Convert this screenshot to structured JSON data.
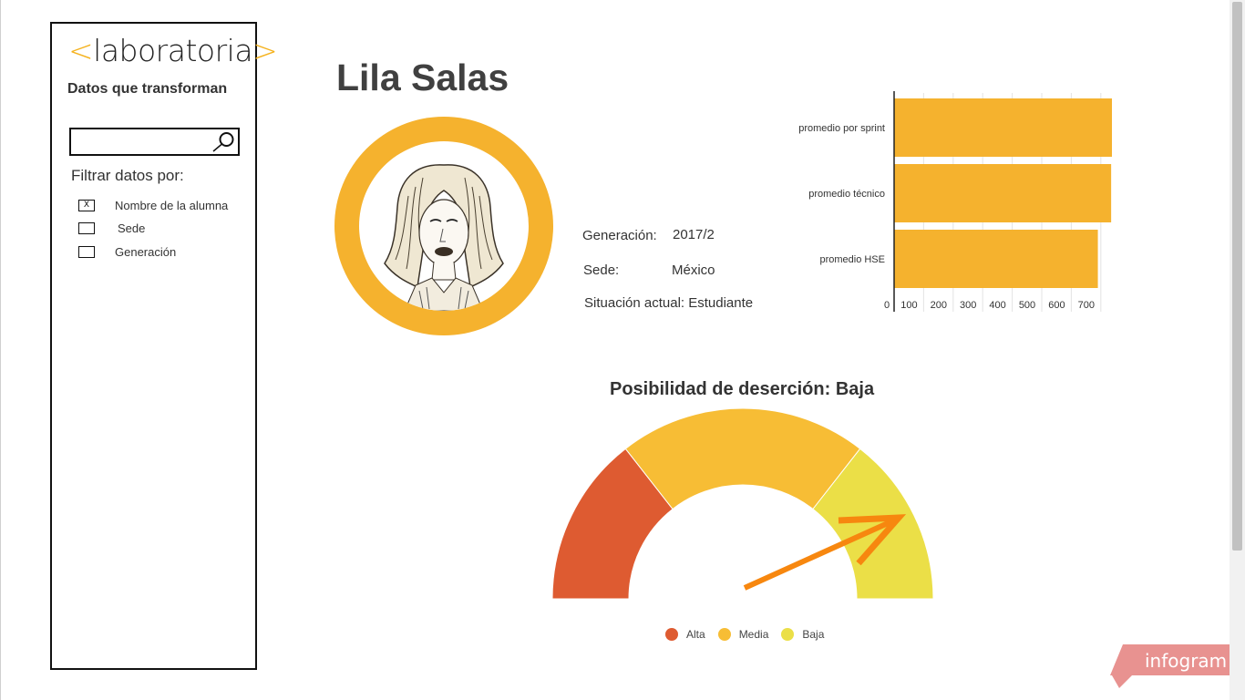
{
  "sidebar": {
    "logo_open": "<",
    "logo_text": "laboratoria",
    "logo_close": ">",
    "tagline": "Datos que transforman",
    "search": {
      "value": "",
      "placeholder": ""
    },
    "filter_title": "Filtrar datos por:",
    "filters": [
      {
        "label": "Nombre de la alumna",
        "checked": true,
        "mark": "X"
      },
      {
        "label": "Sede",
        "checked": false,
        "mark": ""
      },
      {
        "label": "Generación",
        "checked": false,
        "mark": ""
      }
    ]
  },
  "student": {
    "name": "Lila Salas",
    "generation_label": "Generación:",
    "generation_value": "2017/2",
    "sede_label": "Sede:",
    "sede_value": "México",
    "status_text": "Situación actual: Estudiante"
  },
  "chart_data": [
    {
      "type": "bar",
      "orientation": "horizontal",
      "categories": [
        "promedio por sprint",
        "promedio técnico",
        "promedio HSE"
      ],
      "values": [
        750,
        735,
        690
      ],
      "x_ticks": [
        "0",
        "100",
        "200",
        "300",
        "400",
        "500",
        "600",
        "700"
      ],
      "xlim": [
        0,
        700
      ],
      "color": "#f5b22e",
      "grid": true
    },
    {
      "type": "gauge",
      "title": "Posibilidad de deserción: Baja",
      "segments": [
        {
          "name": "Alta",
          "color": "#de5b31"
        },
        {
          "name": "Media",
          "color": "#f7bd35"
        },
        {
          "name": "Baja",
          "color": "#ebdf47"
        }
      ],
      "indicator": "Baja",
      "arrow_color": "#f7870f"
    }
  ],
  "badge": {
    "text": "infogram",
    "color": "#e89290"
  }
}
